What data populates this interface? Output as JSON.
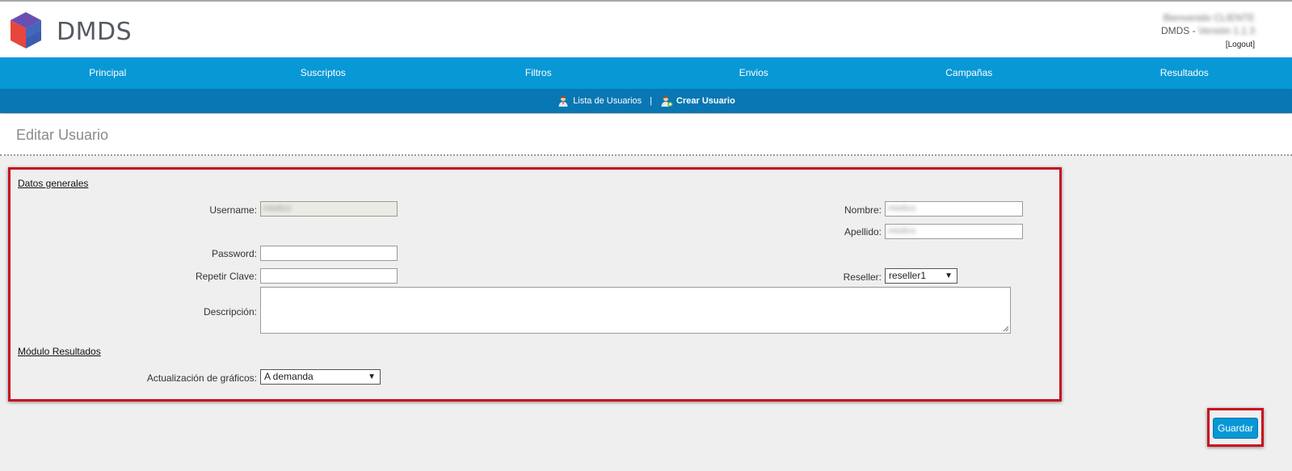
{
  "brand": {
    "name": "DMDS"
  },
  "user_info": {
    "line1": "Bienvenido CLIENTE",
    "line2_prefix": "DMDS - ",
    "line2_version": "Versión 1.1.3",
    "logout": "[Logout]"
  },
  "nav": {
    "items": [
      "Principal",
      "Suscriptos",
      "Filtros",
      "Envios",
      "Campañas",
      "Resultados"
    ]
  },
  "subnav": {
    "list_users": "Lista de Usuarios",
    "separator": "|",
    "create_user": "Crear Usuario"
  },
  "page": {
    "title": "Editar Usuario"
  },
  "form": {
    "section_general": "Datos generales",
    "username_label": "Username:",
    "username_value": "miolico",
    "password_label": "Password:",
    "password_value": "",
    "repeat_label": "Repetir Clave:",
    "repeat_value": "",
    "description_label": "Descripción:",
    "description_value": "",
    "nombre_label": "Nombre:",
    "nombre_value": "miolico",
    "apellido_label": "Apellido:",
    "apellido_value": "miolico",
    "reseller_label": "Reseller:",
    "reseller_value": "reseller1",
    "section_results": "Módulo Resultados",
    "charts_label": "Actualización de gráficos:",
    "charts_value": "A demanda"
  },
  "actions": {
    "save": "Guardar"
  },
  "colors": {
    "nav": "#0898d6",
    "subnav": "#0877b3",
    "highlight": "#c8101e"
  }
}
